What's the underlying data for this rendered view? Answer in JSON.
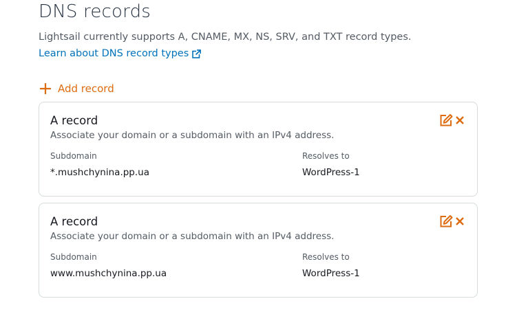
{
  "header": {
    "title": "DNS records",
    "description": "Lightsail currently supports A, CNAME, MX, NS, SRV, and TXT record types.",
    "learn_link": "Learn about DNS record types"
  },
  "add_record_label": "Add record",
  "colors": {
    "accent": "#dd6b10",
    "link": "#0073bb"
  },
  "records": [
    {
      "title": "A record",
      "description": "Associate your domain or a subdomain with an IPv4 address.",
      "subdomain_label": "Subdomain",
      "resolves_label": "Resolves to",
      "subdomain": "*.mushchynina.pp.ua",
      "resolves_to": "WordPress-1"
    },
    {
      "title": "A record",
      "description": "Associate your domain or a subdomain with an IPv4 address.",
      "subdomain_label": "Subdomain",
      "resolves_label": "Resolves to",
      "subdomain": "www.mushchynina.pp.ua",
      "resolves_to": "WordPress-1"
    }
  ]
}
